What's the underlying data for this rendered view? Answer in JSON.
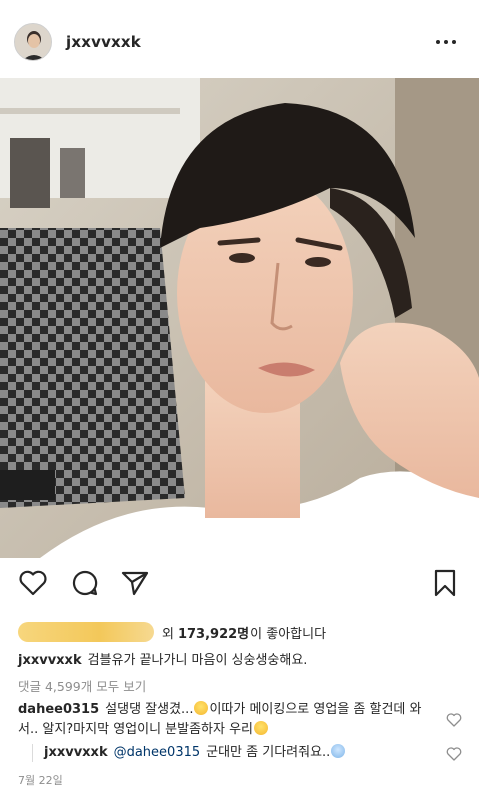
{
  "post": {
    "author": "jxxvvxxk",
    "more_icon": "more-dots-icon"
  },
  "likes": {
    "prefix": "외",
    "count": "173,922명",
    "suffix": "이 좋아합니다"
  },
  "caption": {
    "username": "jxxvvxxk",
    "text": "검블유가 끝나가니 마음이 싱숭생숭해요."
  },
  "comments_link": "댓글 4,599개 모두 보기",
  "comment": {
    "username": "dahee0315",
    "text_1": "설댕댕 잘생겼...",
    "text_2": "이따가 메이킹으로 영업을 좀 할건데 와서.. 알지?마지막 영업이니 분발좀하자 우리"
  },
  "reply": {
    "username": "jxxvvxxk",
    "mention": "@dahee0315",
    "text": "군대만 좀 기다려줘요.."
  },
  "date": "7월 22일",
  "colors": {
    "text": "#262626",
    "muted": "#8e8e8e",
    "mention": "#003569",
    "blur": "#f3c85a"
  }
}
